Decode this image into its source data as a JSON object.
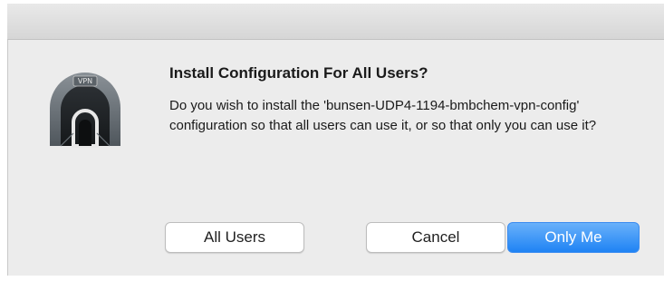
{
  "dialog": {
    "title": "Install Configuration For All Users?",
    "message": "Do you wish to install the 'bunsen-UDP4-1194-bmbchem-vpn-config' configuration so that all users can use it, or so that only you can use it?",
    "icon": "vpn-tunnel-icon",
    "icon_label": "VPN"
  },
  "buttons": {
    "all_users": "All Users",
    "cancel": "Cancel",
    "only_me": "Only Me"
  },
  "colors": {
    "primary_button": "#1f83f4",
    "dialog_background": "#ececec"
  }
}
